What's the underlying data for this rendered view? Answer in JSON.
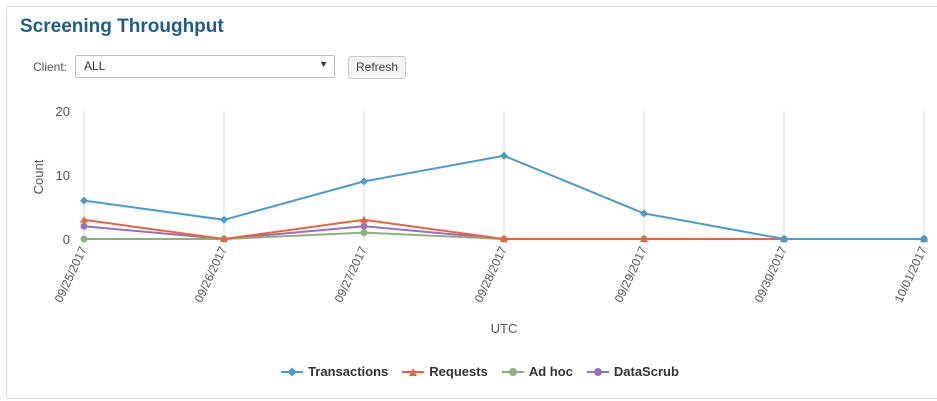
{
  "panel": {
    "title": "Screening Throughput"
  },
  "controls": {
    "client_label": "Client:",
    "client_value": "ALL",
    "refresh_label": "Refresh"
  },
  "chart_data": {
    "type": "line",
    "categories": [
      "09/25/2017",
      "09/26/2017",
      "09/27/2017",
      "09/28/2017",
      "09/29/2017",
      "09/30/2017",
      "10/01/2017"
    ],
    "xlabel": "UTC",
    "ylabel": "Count",
    "ylim": [
      0,
      20
    ],
    "yticks": [
      0,
      10,
      20
    ],
    "grid": "vertical",
    "legend_position": "bottom",
    "series": [
      {
        "name": "Transactions",
        "color": "#4a9bcf",
        "marker": "diamond",
        "values": [
          6,
          3,
          9,
          13,
          4,
          0,
          0
        ]
      },
      {
        "name": "Requests",
        "color": "#e8643e",
        "marker": "triangle",
        "values": [
          3,
          0,
          3,
          0,
          0,
          0,
          0
        ]
      },
      {
        "name": "Ad hoc",
        "color": "#8bb27a",
        "marker": "circle",
        "values": [
          0,
          0,
          1,
          0,
          0,
          0,
          0
        ]
      },
      {
        "name": "DataScrub",
        "color": "#9b6dbd",
        "marker": "circle",
        "values": [
          2,
          0,
          2,
          0,
          0,
          0,
          0
        ]
      }
    ]
  }
}
